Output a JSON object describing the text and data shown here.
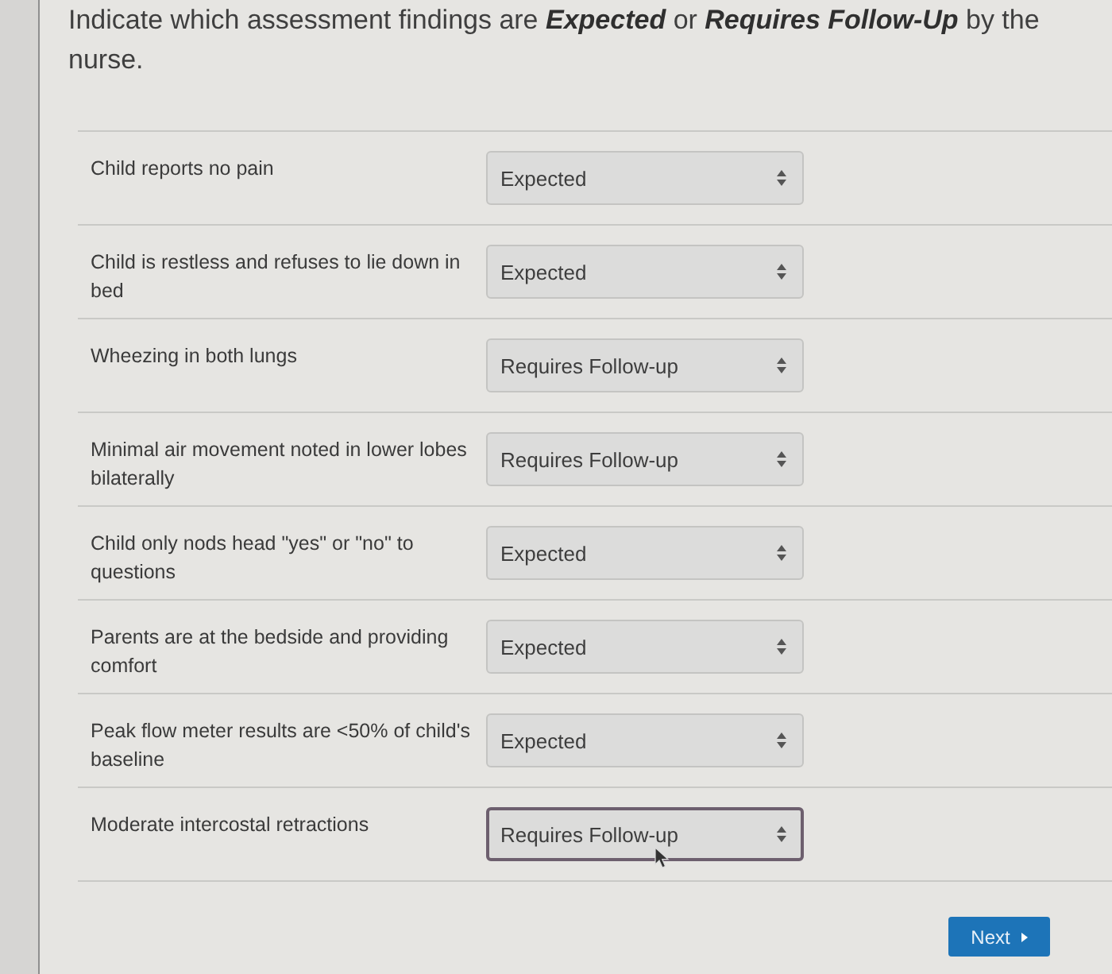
{
  "prompt": "Indicate which assessment findings are **Expected** or **Requires Follow-Up** by the nurse.",
  "findings": [
    {
      "label": "Child reports no pain",
      "answer": "Expected",
      "focused": false
    },
    {
      "label": "Child is restless and refuses to lie down in bed",
      "answer": "Expected",
      "focused": false
    },
    {
      "label": "Wheezing in both lungs",
      "answer": "Requires Follow-up",
      "focused": false
    },
    {
      "label": "Minimal air movement noted in lower lobes bilaterally",
      "answer": "Requires Follow-up",
      "focused": false
    },
    {
      "label": "Child only nods head \"yes\" or \"no\" to questions",
      "answer": "Expected",
      "focused": false
    },
    {
      "label": "Parents are at the bedside and providing comfort",
      "answer": "Expected",
      "focused": false
    },
    {
      "label": "Peak flow meter results are <50% of child's baseline",
      "answer": "Expected",
      "focused": false
    },
    {
      "label": "Moderate intercostal retractions",
      "answer": "Requires Follow-up",
      "focused": true
    }
  ],
  "next_button": {
    "label": "Next"
  }
}
